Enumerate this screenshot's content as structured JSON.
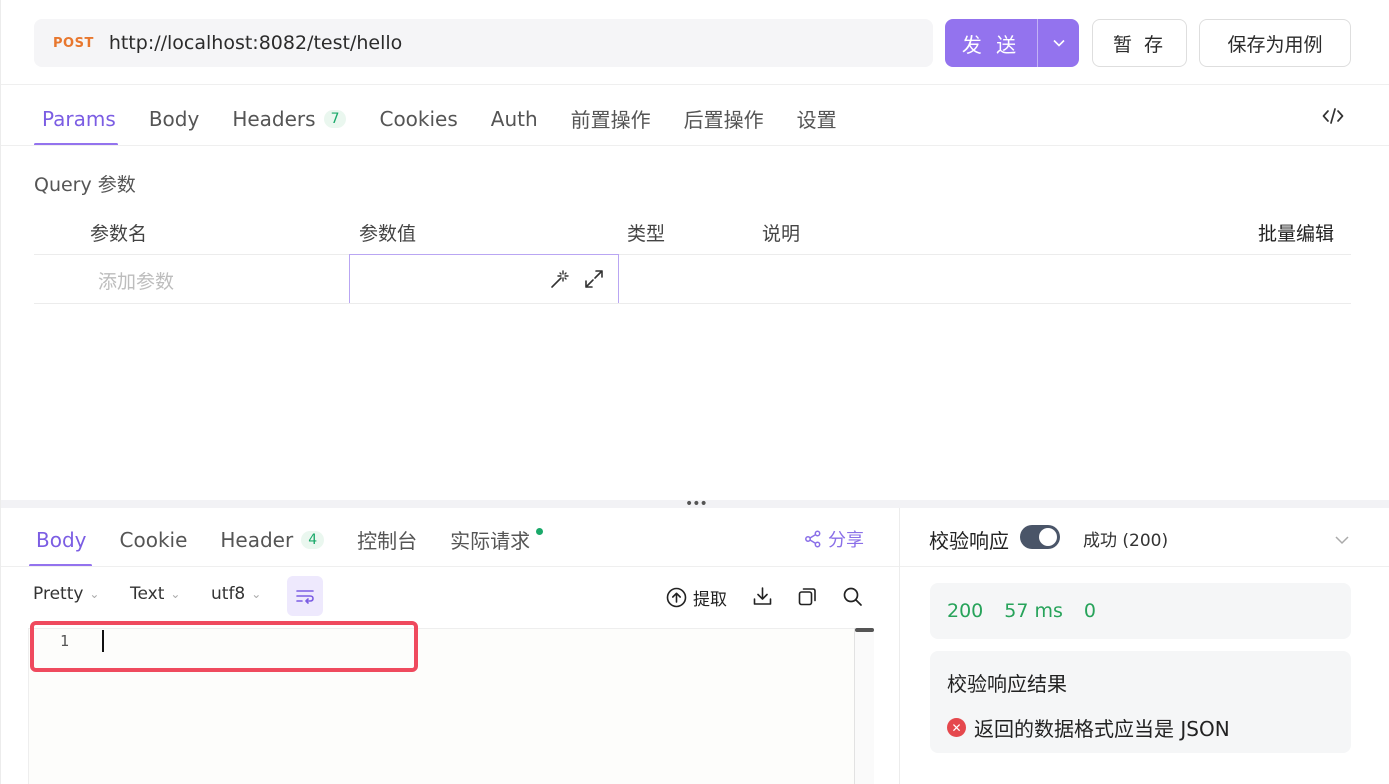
{
  "request": {
    "method": "POST",
    "url": "http://localhost:8082/test/hello",
    "send_label": "发 送",
    "save_label": "暂 存",
    "save_case_label": "保存为用例"
  },
  "request_tabs": [
    {
      "label": "Params",
      "active": true
    },
    {
      "label": "Body"
    },
    {
      "label": "Headers",
      "badge": "7"
    },
    {
      "label": "Cookies"
    },
    {
      "label": "Auth"
    },
    {
      "label": "前置操作"
    },
    {
      "label": "后置操作"
    },
    {
      "label": "设置"
    }
  ],
  "params": {
    "section_title": "Query 参数",
    "columns": [
      "参数名",
      "参数值",
      "类型",
      "说明"
    ],
    "bulk_edit_label": "批量编辑",
    "add_param_placeholder": "添加参数"
  },
  "response_tabs": [
    {
      "label": "Body",
      "active": true
    },
    {
      "label": "Cookie"
    },
    {
      "label": "Header",
      "badge": "4"
    },
    {
      "label": "控制台"
    },
    {
      "label": "实际请求",
      "dot": true
    }
  ],
  "share_label": "分享",
  "viewer": {
    "format": "Pretty",
    "type": "Text",
    "encoding": "utf8",
    "extract_label": "提取",
    "line_number": "1"
  },
  "validation": {
    "label": "校验响应",
    "enabled": true,
    "status": "成功 (200)",
    "metrics": {
      "status_code": "200",
      "time": "57 ms",
      "size": "0"
    },
    "result_title": "校验响应结果",
    "result_message": "返回的数据格式应当是 JSON"
  },
  "colors": {
    "accent": "#9373ee",
    "method_post": "#e8772e",
    "success": "#27a35a",
    "error": "#e5484d",
    "highlight": "#ef4a5e"
  }
}
